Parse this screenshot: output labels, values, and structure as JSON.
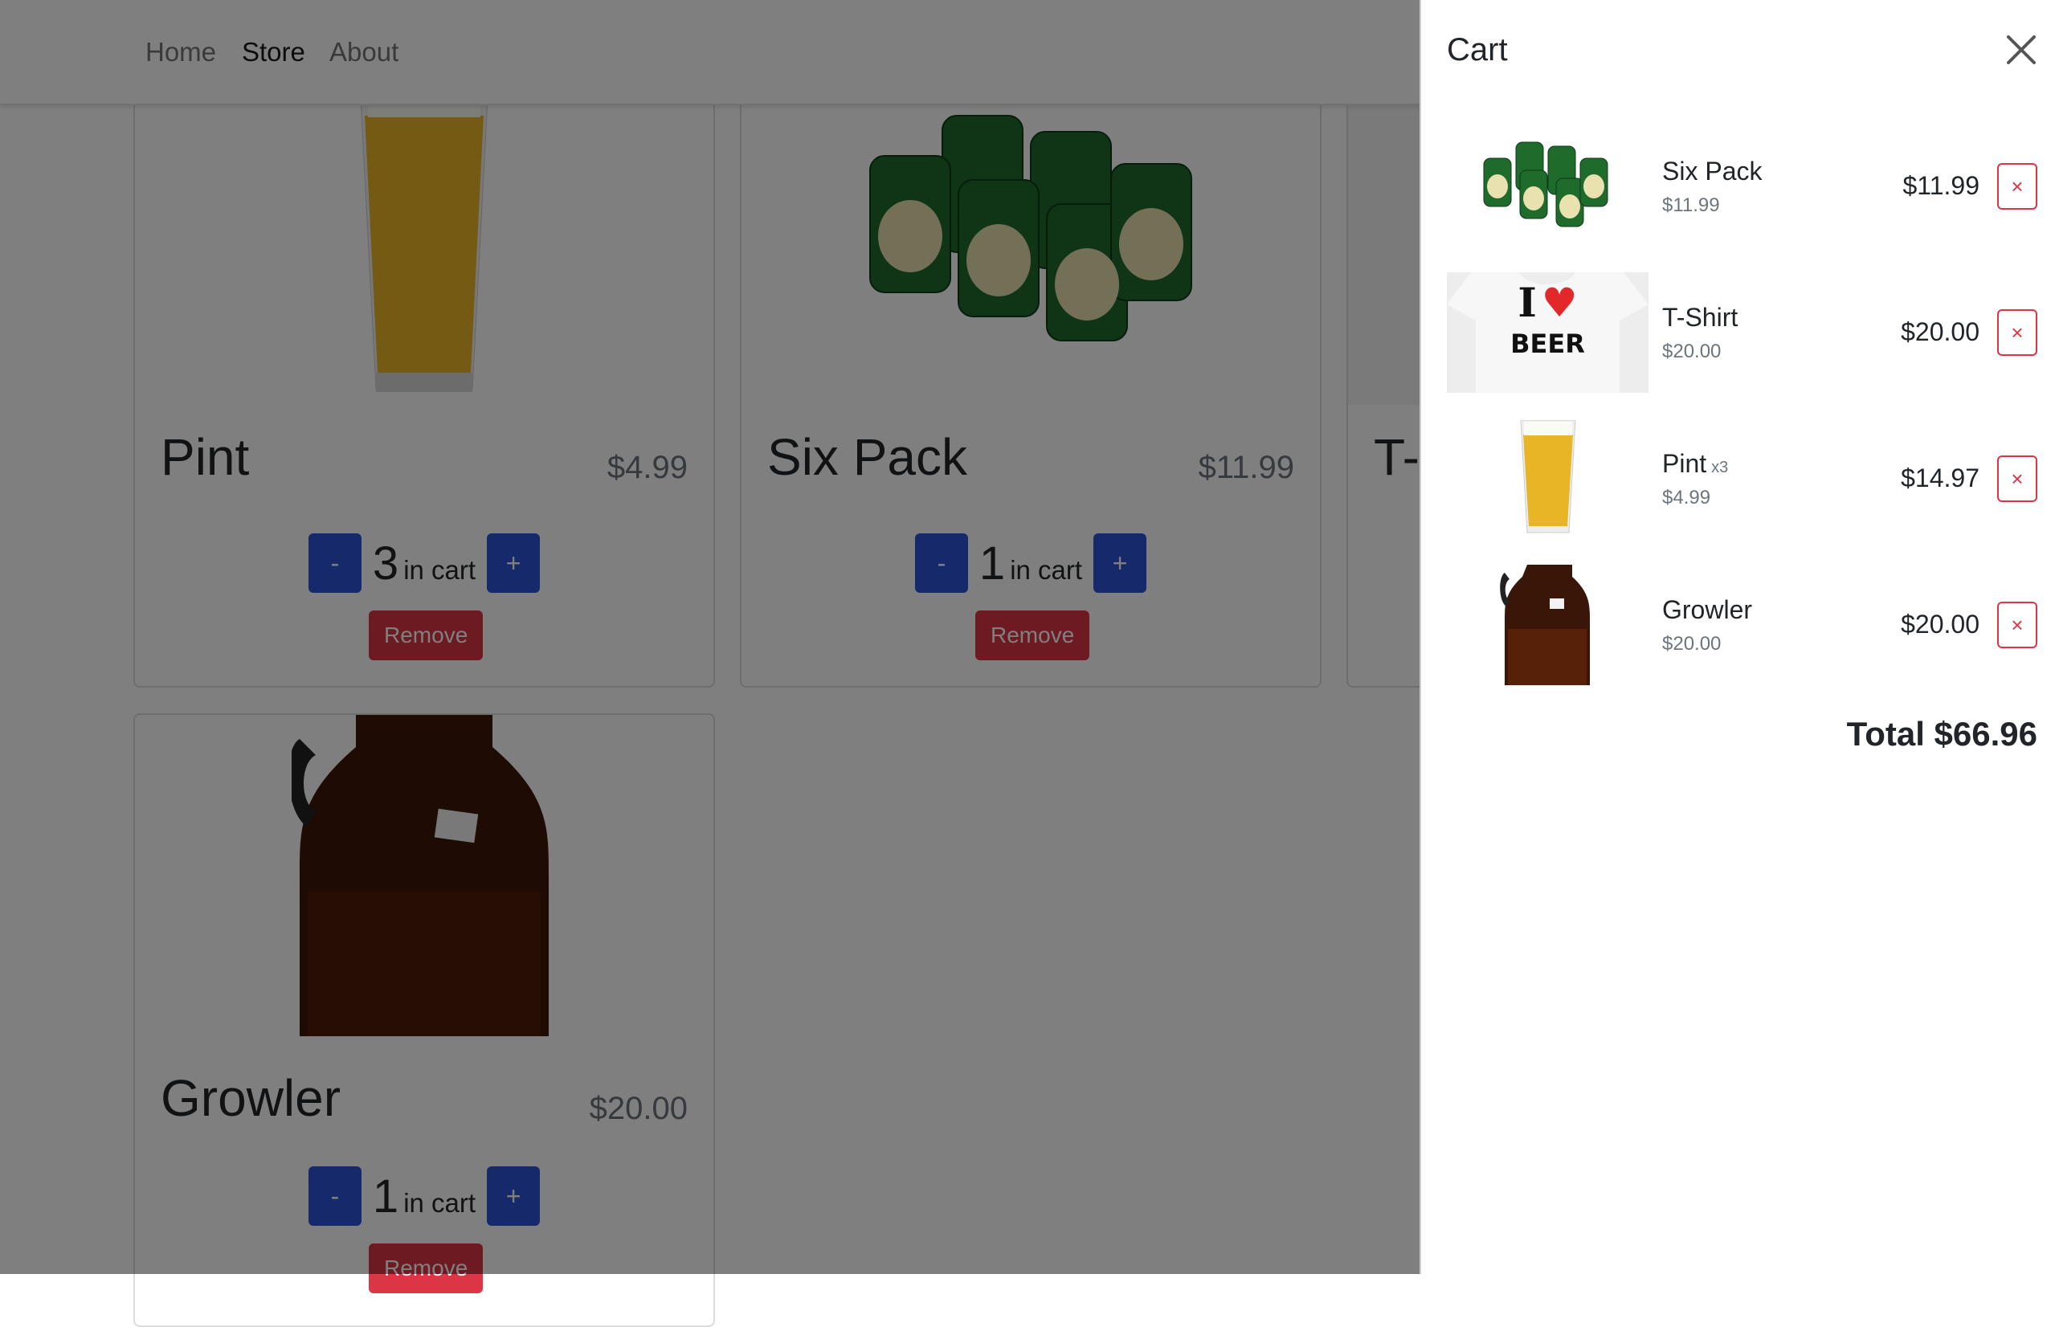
{
  "nav": {
    "items": [
      "Home",
      "Store",
      "About"
    ],
    "active": "Store"
  },
  "store": {
    "products": [
      {
        "name": "Pint",
        "price": "$4.99",
        "qty": "3",
        "in_cart_label": "in cart",
        "minus": "-",
        "plus": "+",
        "remove": "Remove"
      },
      {
        "name": "Six Pack",
        "price": "$11.99",
        "qty": "1",
        "in_cart_label": "in cart",
        "minus": "-",
        "plus": "+",
        "remove": "Remove"
      },
      {
        "name": "T-",
        "price": "",
        "qty": "",
        "in_cart_label": "",
        "minus": "",
        "plus": "",
        "remove": ""
      },
      {
        "name": "Growler",
        "price": "$20.00",
        "qty": "1",
        "in_cart_label": "in cart",
        "minus": "-",
        "plus": "+",
        "remove": "Remove"
      }
    ]
  },
  "cart": {
    "title": "Cart",
    "items": [
      {
        "name": "Six Pack",
        "multiplier": "",
        "unit_price": "$11.99",
        "line_total": "$11.99",
        "remove": "×",
        "image": "six-pack"
      },
      {
        "name": "T-Shirt",
        "multiplier": "",
        "unit_price": "$20.00",
        "line_total": "$20.00",
        "remove": "×",
        "image": "t-shirt"
      },
      {
        "name": "Pint",
        "multiplier": "x3",
        "unit_price": "$4.99",
        "line_total": "$14.97",
        "remove": "×",
        "image": "pint"
      },
      {
        "name": "Growler",
        "multiplier": "",
        "unit_price": "$20.00",
        "line_total": "$20.00",
        "remove": "×",
        "image": "growler"
      }
    ],
    "total": "Total $66.96"
  },
  "tshirt_print": {
    "line1": "I",
    "line2": "BEER"
  },
  "colors": {
    "primary": "#2b53d6",
    "danger": "#dc3545",
    "overlay": "rgba(0,0,0,0.5)"
  }
}
